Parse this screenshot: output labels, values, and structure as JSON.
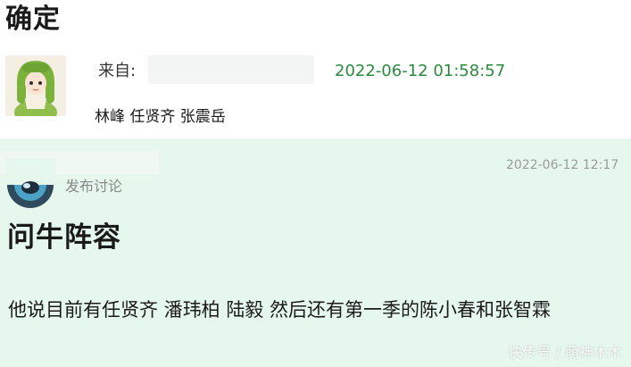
{
  "top": {
    "title": "确定",
    "from_label": "来自:",
    "timestamp": "2022-06-12 01:58:57",
    "names": "林峰 任贤齐 张震岳"
  },
  "post": {
    "action": "发布讨论",
    "timestamp": "2022-06-12 12:17",
    "title": "问牛阵容",
    "body": "他说目前有任贤齐 潘玮柏 陆毅 然后还有第一季的陈小春和张智霖"
  },
  "watermark": "快传号 / 萌神木木",
  "colors": {
    "timestamp_green": "#2a8a3e",
    "post_background": "#e6f8ee"
  }
}
